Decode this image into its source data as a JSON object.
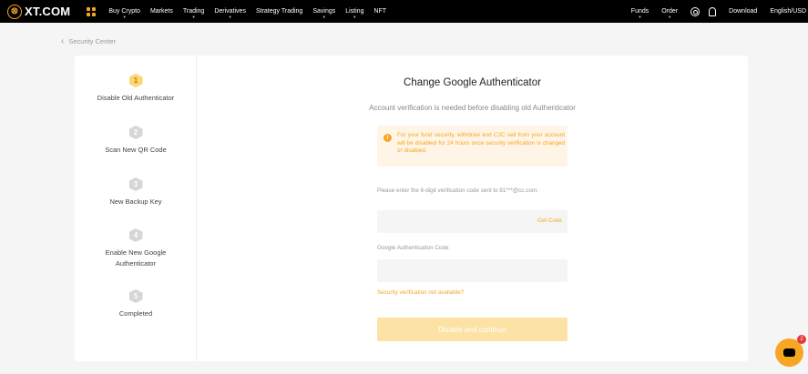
{
  "brand": {
    "logo_mark": "⊗",
    "name": "XT.COM",
    "accent_color": "#f5a623"
  },
  "nav": {
    "items": [
      {
        "label": "Buy Crypto",
        "has_dropdown": true
      },
      {
        "label": "Markets",
        "has_dropdown": false
      },
      {
        "label": "Trading",
        "has_dropdown": true
      },
      {
        "label": "Derivatives",
        "has_dropdown": true
      },
      {
        "label": "Strategy Trading",
        "has_dropdown": false
      },
      {
        "label": "Savings",
        "has_dropdown": true
      },
      {
        "label": "Listing",
        "has_dropdown": true
      },
      {
        "label": "NFT",
        "has_dropdown": false
      }
    ],
    "right": {
      "funds": "Funds",
      "order": "Order",
      "download": "Download",
      "locale": "English/USD"
    },
    "icons": [
      "apps-icon",
      "user-icon",
      "bell-icon"
    ]
  },
  "breadcrumb": {
    "back_label": "Security Center"
  },
  "steps": [
    {
      "number": "1",
      "label": "Disable Old Authenticator",
      "active": true
    },
    {
      "number": "2",
      "label": "Scan New QR Code",
      "active": false
    },
    {
      "number": "3",
      "label": "New Backup Key",
      "active": false
    },
    {
      "number": "4",
      "label": "Enable New Google Authenticator",
      "active": false
    },
    {
      "number": "5",
      "label": "Completed",
      "active": false
    }
  ],
  "main": {
    "title": "Change Google Authenticator",
    "subtitle": "Account verification is needed before disabling old Authenticator",
    "warning": "For your fund security, withdraw and C2C sell from your account will be disabled for 24 hours once security verification is changed or disabled.",
    "email_code_label": "Please enter the 6-digit verification code sent to 81***@cc.com:",
    "email_code_value": "",
    "get_code": "Get Code",
    "google_code_label": "Google Authentication Code:",
    "google_code_value": "",
    "unavailable_link": "Security verification not available?",
    "submit_label": "Disable and continue"
  },
  "chat": {
    "badge_count": "2"
  }
}
